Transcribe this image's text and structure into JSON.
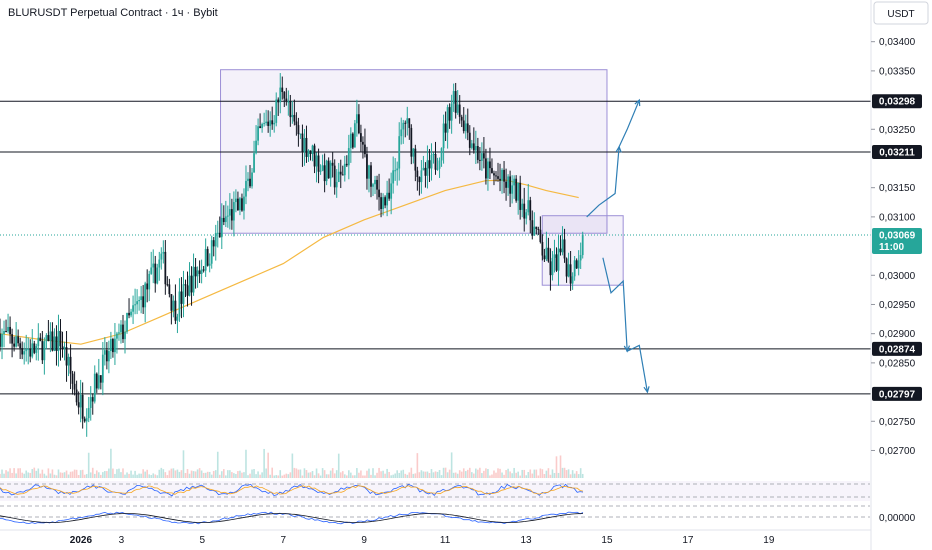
{
  "header": {
    "title": "BLURUSDT Perpetual Contract · 1ч · Bybit",
    "currency": "USDT"
  },
  "chart_data": {
    "type": "candlestick",
    "symbol": "BLURUSDT",
    "timeframe": "1ч",
    "exchange": "Bybit",
    "ylim": [
      0.0267,
      0.0342
    ],
    "xlim": [
      0,
      21.5
    ],
    "y_ticks": [
      "0,03400",
      "0,03350",
      "0,03250",
      "0,03150",
      "0,03100",
      "0,03000",
      "0,02950",
      "0,02900",
      "0,02850",
      "0,02750",
      "0,02700"
    ],
    "y_tick_values": [
      0.034,
      0.0335,
      0.0325,
      0.0315,
      0.031,
      0.03,
      0.0295,
      0.029,
      0.0285,
      0.0275,
      0.027
    ],
    "x_ticks": [
      "2026",
      "3",
      "5",
      "7",
      "9",
      "11",
      "13",
      "15",
      "17",
      "19"
    ],
    "x_tick_values": [
      2,
      3,
      5,
      7,
      9,
      11,
      13,
      15,
      17,
      19
    ],
    "horizontal_levels": [
      {
        "label": "0,03298",
        "value": 0.03298
      },
      {
        "label": "0,03211",
        "value": 0.03211
      },
      {
        "label": "0,02874",
        "value": 0.02874
      },
      {
        "label": "0,02797",
        "value": 0.02797
      }
    ],
    "current_price": {
      "label": "0,03069",
      "countdown": "11:00",
      "value": 0.03069
    },
    "oscillator_label": "0,00000",
    "zones": [
      {
        "x0": 5.45,
        "x1": 15.0,
        "y0": 0.03072,
        "y1": 0.03352
      },
      {
        "x0": 13.4,
        "x1": 15.4,
        "y0": 0.02983,
        "y1": 0.03102
      }
    ],
    "moving_average": [
      [
        0,
        0.029
      ],
      [
        1,
        0.0289
      ],
      [
        2,
        0.02882
      ],
      [
        3,
        0.029
      ],
      [
        4,
        0.0293
      ],
      [
        5,
        0.0296
      ],
      [
        6,
        0.0299
      ],
      [
        7,
        0.0302
      ],
      [
        8,
        0.03065
      ],
      [
        9,
        0.03095
      ],
      [
        10,
        0.0312
      ],
      [
        11,
        0.03145
      ],
      [
        12,
        0.03162
      ],
      [
        12.5,
        0.03163
      ],
      [
        13,
        0.03155
      ],
      [
        13.5,
        0.03145
      ],
      [
        14.3,
        0.03133
      ]
    ],
    "price_path": [
      [
        0,
        0.029
      ],
      [
        0.8,
        0.0287
      ],
      [
        1.5,
        0.0289
      ],
      [
        1.9,
        0.0279
      ],
      [
        2.1,
        0.0277
      ],
      [
        2.5,
        0.0284
      ],
      [
        3.0,
        0.029
      ],
      [
        3.5,
        0.0296
      ],
      [
        4.0,
        0.0303
      ],
      [
        4.3,
        0.0294
      ],
      [
        4.8,
        0.03
      ],
      [
        5.2,
        0.0304
      ],
      [
        5.6,
        0.031
      ],
      [
        6.0,
        0.0312
      ],
      [
        6.4,
        0.0324
      ],
      [
        6.8,
        0.0328
      ],
      [
        7.0,
        0.0333
      ],
      [
        7.2,
        0.0326
      ],
      [
        7.6,
        0.0322
      ],
      [
        8.0,
        0.0318
      ],
      [
        8.4,
        0.0316
      ],
      [
        8.8,
        0.0326
      ],
      [
        9.2,
        0.0315
      ],
      [
        9.6,
        0.0312
      ],
      [
        10.0,
        0.0327
      ],
      [
        10.4,
        0.0316
      ],
      [
        10.8,
        0.032
      ],
      [
        11.2,
        0.0331
      ],
      [
        11.6,
        0.0324
      ],
      [
        12.0,
        0.0318
      ],
      [
        12.4,
        0.0316
      ],
      [
        12.8,
        0.0314
      ],
      [
        13.1,
        0.031
      ],
      [
        13.3,
        0.0306
      ],
      [
        13.6,
        0.0301
      ],
      [
        13.9,
        0.0304
      ],
      [
        14.1,
        0.03
      ],
      [
        14.4,
        0.0306
      ]
    ],
    "projection_up": [
      [
        14.5,
        0.031
      ],
      [
        14.8,
        0.0312
      ],
      [
        15.2,
        0.0314
      ],
      [
        15.3,
        0.0322
      ],
      [
        15.5,
        0.0325
      ],
      [
        15.8,
        0.033
      ]
    ],
    "projection_down": [
      [
        14.9,
        0.0303
      ],
      [
        15.1,
        0.0297
      ],
      [
        15.4,
        0.0299
      ],
      [
        15.5,
        0.0287
      ],
      [
        15.8,
        0.0288
      ],
      [
        16.0,
        0.028
      ]
    ]
  }
}
